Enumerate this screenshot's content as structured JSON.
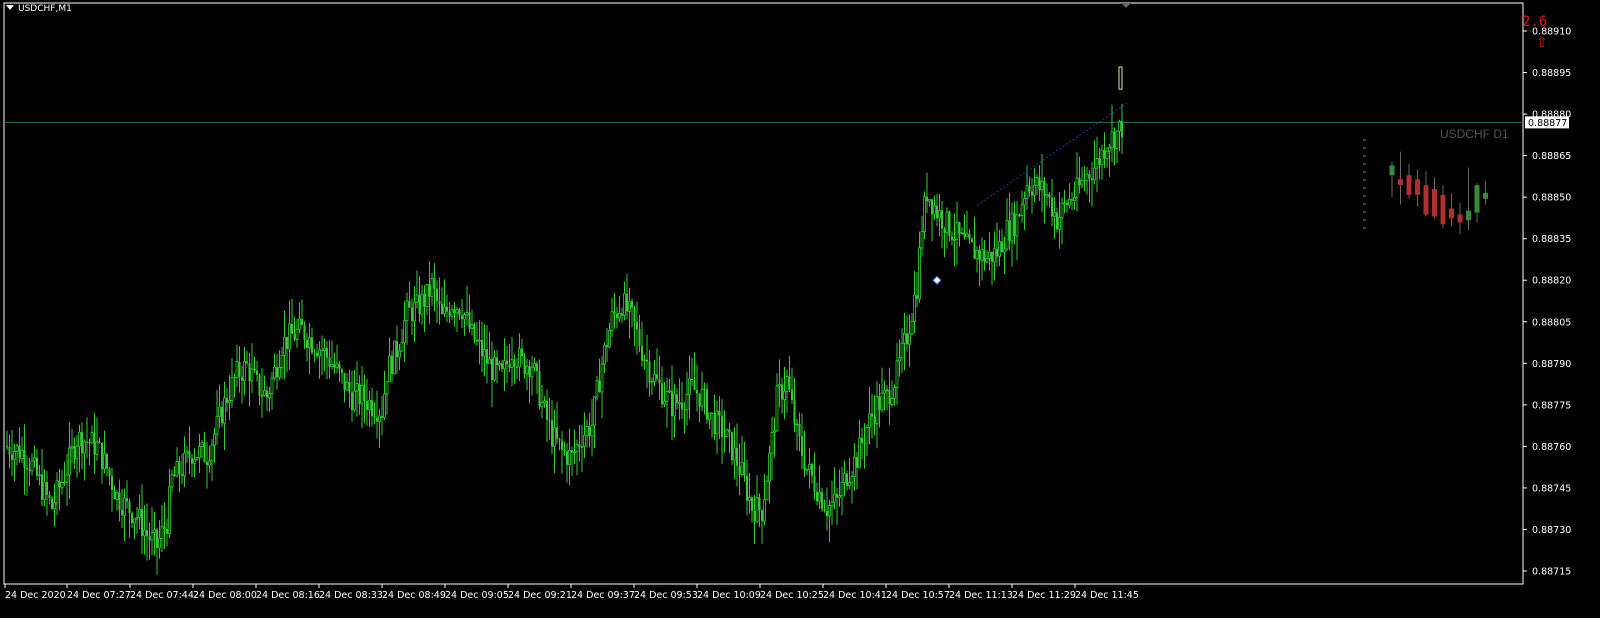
{
  "window": {
    "title": "USDCHF,M1"
  },
  "indicator": {
    "spread": "2.6",
    "arrow_glyph": "⇧",
    "color": "#e01010"
  },
  "mini_chart": {
    "title": "USDCHF D1"
  },
  "colors": {
    "background": "#000000",
    "candle": "#32cd32",
    "axis": "#ffffff",
    "price_line": "#2f6f4f",
    "bid_label_bg": "#ffffff",
    "bid_label_fg": "#000000",
    "trendline": "#1e3aa8",
    "bear": "#b03030"
  },
  "chart_data": {
    "type": "candlestick",
    "symbol": "USDCHF",
    "timeframe": "M1",
    "current_price_label": "0.88877",
    "y_ticks": [
      "0.88910",
      "0.88895",
      "0.88880",
      "0.88865",
      "0.88850",
      "0.88835",
      "0.88820",
      "0.88805",
      "0.88790",
      "0.88775",
      "0.88760",
      "0.88745",
      "0.88730",
      "0.88715"
    ],
    "y_range": [
      0.88715,
      0.8891
    ],
    "x_ticks": [
      "24 Dec 2020",
      "24 Dec 07:27",
      "24 Dec 07:44",
      "24 Dec 08:00",
      "24 Dec 08:16",
      "24 Dec 08:33",
      "24 Dec 08:49",
      "24 Dec 09:05",
      "24 Dec 09:21",
      "24 Dec 09:37",
      "24 Dec 09:53",
      "24 Dec 10:09",
      "24 Dec 10:25",
      "24 Dec 10:41",
      "24 Dec 10:57",
      "24 Dec 11:13",
      "24 Dec 11:29",
      "24 Dec 11:45"
    ],
    "close_path": [
      [
        0,
        0.8876
      ],
      [
        6,
        0.88758
      ],
      [
        10,
        0.88753
      ],
      [
        14,
        0.88745
      ],
      [
        18,
        0.88738
      ],
      [
        20,
        0.88743
      ],
      [
        24,
        0.88752
      ],
      [
        28,
        0.88763
      ],
      [
        32,
        0.88762
      ],
      [
        36,
        0.8876
      ],
      [
        40,
        0.88752
      ],
      [
        44,
        0.88742
      ],
      [
        48,
        0.88738
      ],
      [
        52,
        0.88735
      ],
      [
        56,
        0.88728
      ],
      [
        60,
        0.88724
      ],
      [
        64,
        0.88733
      ],
      [
        66,
        0.88748
      ],
      [
        70,
        0.88752
      ],
      [
        74,
        0.88758
      ],
      [
        80,
        0.88757
      ],
      [
        84,
        0.88767
      ],
      [
        88,
        0.88778
      ],
      [
        92,
        0.88786
      ],
      [
        96,
        0.88789
      ],
      [
        100,
        0.88782
      ],
      [
        104,
        0.88778
      ],
      [
        108,
        0.8879
      ],
      [
        110,
        0.88797
      ],
      [
        114,
        0.888
      ],
      [
        118,
        0.88802
      ],
      [
        122,
        0.88798
      ],
      [
        126,
        0.88795
      ],
      [
        130,
        0.8879
      ],
      [
        134,
        0.88784
      ],
      [
        138,
        0.88778
      ],
      [
        142,
        0.88778
      ],
      [
        146,
        0.88775
      ],
      [
        150,
        0.88773
      ],
      [
        152,
        0.88787
      ],
      [
        156,
        0.88795
      ],
      [
        160,
        0.88808
      ],
      [
        164,
        0.8881
      ],
      [
        168,
        0.88814
      ],
      [
        170,
        0.88818
      ],
      [
        174,
        0.88806
      ],
      [
        178,
        0.88812
      ],
      [
        182,
        0.8881
      ],
      [
        186,
        0.888
      ],
      [
        190,
        0.88794
      ],
      [
        194,
        0.88788
      ],
      [
        198,
        0.88785
      ],
      [
        202,
        0.88795
      ],
      [
        206,
        0.8879
      ],
      [
        210,
        0.8879
      ],
      [
        214,
        0.88775
      ],
      [
        218,
        0.88764
      ],
      [
        222,
        0.88758
      ],
      [
        226,
        0.88756
      ],
      [
        230,
        0.88764
      ],
      [
        234,
        0.88768
      ],
      [
        238,
        0.8879
      ],
      [
        242,
        0.88806
      ],
      [
        246,
        0.88812
      ],
      [
        250,
        0.88806
      ],
      [
        254,
        0.88795
      ],
      [
        258,
        0.88786
      ],
      [
        262,
        0.8878
      ],
      [
        266,
        0.88775
      ],
      [
        270,
        0.88777
      ],
      [
        274,
        0.88781
      ],
      [
        278,
        0.88778
      ],
      [
        282,
        0.8877
      ],
      [
        286,
        0.88766
      ],
      [
        290,
        0.88759
      ],
      [
        294,
        0.8875
      ],
      [
        298,
        0.88738
      ],
      [
        302,
        0.88737
      ],
      [
        306,
        0.88762
      ],
      [
        308,
        0.88777
      ],
      [
        312,
        0.88784
      ],
      [
        316,
        0.88764
      ],
      [
        320,
        0.88752
      ],
      [
        324,
        0.88745
      ],
      [
        328,
        0.88738
      ],
      [
        332,
        0.8874
      ],
      [
        336,
        0.8875
      ],
      [
        340,
        0.88756
      ],
      [
        344,
        0.88767
      ],
      [
        348,
        0.88775
      ],
      [
        352,
        0.88778
      ],
      [
        356,
        0.88786
      ],
      [
        360,
        0.888
      ],
      [
        364,
        0.88818
      ],
      [
        366,
        0.8884
      ],
      [
        368,
        0.88852
      ],
      [
        372,
        0.88845
      ],
      [
        376,
        0.8884
      ],
      [
        380,
        0.88836
      ],
      [
        384,
        0.88832
      ],
      [
        388,
        0.8883
      ],
      [
        392,
        0.88828
      ],
      [
        396,
        0.8883
      ],
      [
        400,
        0.88838
      ],
      [
        404,
        0.88842
      ],
      [
        408,
        0.88855
      ],
      [
        412,
        0.88854
      ],
      [
        416,
        0.88851
      ],
      [
        420,
        0.88842
      ],
      [
        424,
        0.88848
      ],
      [
        428,
        0.88852
      ],
      [
        432,
        0.88858
      ],
      [
        436,
        0.88862
      ],
      [
        440,
        0.8887
      ],
      [
        444,
        0.88873
      ],
      [
        448,
        0.88878
      ],
      [
        452,
        0.88883
      ],
      [
        454,
        0.88888
      ],
      [
        456,
        0.88897
      ],
      [
        458,
        0.88895
      ]
    ],
    "trendline": {
      "from": [
        388,
        0.88847
      ],
      "to": [
        448,
        0.88884
      ]
    },
    "marker_at": [
      370,
      0.8882
    ],
    "daily_candles": [
      {
        "o": 0.88862,
        "h": 0.88869,
        "l": 0.88851,
        "c": 0.88867
      },
      {
        "o": 0.8886,
        "h": 0.88874,
        "l": 0.88847,
        "c": 0.88857
      },
      {
        "o": 0.88862,
        "h": 0.88868,
        "l": 0.8885,
        "c": 0.88852
      },
      {
        "o": 0.8886,
        "h": 0.88865,
        "l": 0.88846,
        "c": 0.88852
      },
      {
        "o": 0.88857,
        "h": 0.88864,
        "l": 0.88841,
        "c": 0.88842
      },
      {
        "o": 0.88855,
        "h": 0.88861,
        "l": 0.8884,
        "c": 0.88841
      },
      {
        "o": 0.88852,
        "h": 0.88857,
        "l": 0.88835,
        "c": 0.88837
      },
      {
        "o": 0.88845,
        "h": 0.88853,
        "l": 0.88836,
        "c": 0.8884
      },
      {
        "o": 0.88842,
        "h": 0.88848,
        "l": 0.88832,
        "c": 0.88838
      },
      {
        "o": 0.88839,
        "h": 0.88866,
        "l": 0.88834,
        "c": 0.88844
      },
      {
        "o": 0.88843,
        "h": 0.88858,
        "l": 0.88838,
        "c": 0.88857
      },
      {
        "o": 0.8885,
        "h": 0.88859,
        "l": 0.88847,
        "c": 0.88853
      }
    ]
  }
}
